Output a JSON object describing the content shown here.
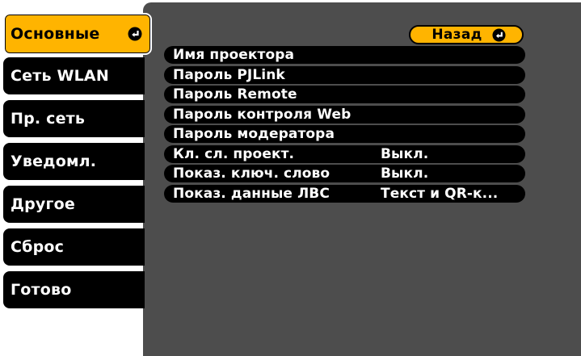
{
  "tabs": [
    {
      "label": "Основные",
      "selected": true
    },
    {
      "label": "Сеть WLAN",
      "selected": false
    },
    {
      "label": "Пр. сеть",
      "selected": false
    },
    {
      "label": "Уведомл.",
      "selected": false
    },
    {
      "label": "Другое",
      "selected": false
    },
    {
      "label": "Сброс",
      "selected": false
    },
    {
      "label": "Готово",
      "selected": false
    }
  ],
  "back_button": {
    "label": "Назад",
    "icon": "enter-icon"
  },
  "menu": [
    {
      "label": "Имя проектора",
      "value": ""
    },
    {
      "label": "Пароль PJLink",
      "value": ""
    },
    {
      "label": "Пароль Remote",
      "value": ""
    },
    {
      "label": "Пароль контроля Web",
      "value": ""
    },
    {
      "label": "Пароль модератора",
      "value": ""
    },
    {
      "label": "Кл. сл. проект.",
      "value": "Выкл."
    },
    {
      "label": "Показ. ключ. слово",
      "value": "Выкл."
    },
    {
      "label": "Показ. данные ЛВС",
      "value": "Текст и QR-к..."
    }
  ],
  "colors": {
    "accent": "#ffb400",
    "panel": "#4d4d4d",
    "item_bg": "#000000",
    "text": "#ffffff"
  }
}
